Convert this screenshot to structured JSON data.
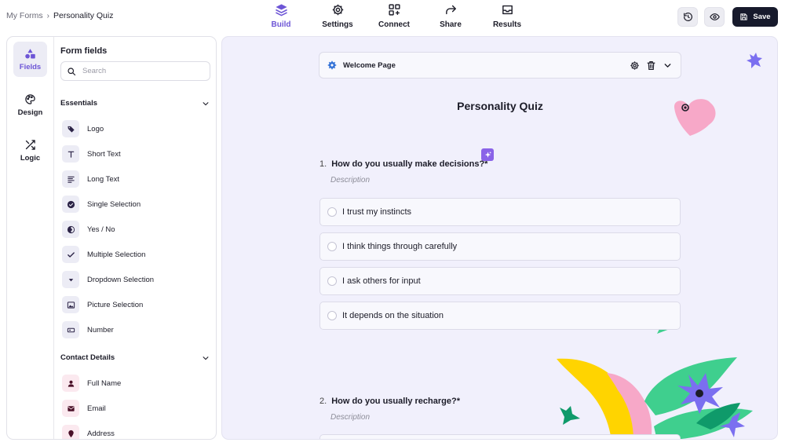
{
  "breadcrumb": {
    "parent": "My Forms",
    "separator": "›",
    "current": "Personality Quiz"
  },
  "nav_tabs": [
    {
      "label": "Build",
      "icon": "layers-icon",
      "active": true
    },
    {
      "label": "Settings",
      "icon": "gear-icon",
      "active": false
    },
    {
      "label": "Connect",
      "icon": "connect-icon",
      "active": false
    },
    {
      "label": "Share",
      "icon": "share-icon",
      "active": false
    },
    {
      "label": "Results",
      "icon": "inbox-icon",
      "active": false
    }
  ],
  "actions": {
    "save_label": "Save"
  },
  "rail": [
    {
      "label": "Fields",
      "icon": "shapes-icon",
      "active": true
    },
    {
      "label": "Design",
      "icon": "palette-icon",
      "active": false
    },
    {
      "label": "Logic",
      "icon": "shuffle-icon",
      "active": false
    }
  ],
  "fields_panel": {
    "title": "Form fields",
    "search_placeholder": "Search",
    "sections": [
      {
        "title": "Essentials",
        "items": [
          {
            "label": "Logo",
            "icon": "tag-icon"
          },
          {
            "label": "Short Text",
            "icon": "text-icon"
          },
          {
            "label": "Long Text",
            "icon": "paragraph-icon"
          },
          {
            "label": "Single Selection",
            "icon": "check-circle-icon"
          },
          {
            "label": "Yes / No",
            "icon": "half-circle-icon"
          },
          {
            "label": "Multiple Selection",
            "icon": "checkmark-icon"
          },
          {
            "label": "Dropdown Selection",
            "icon": "dropdown-icon"
          },
          {
            "label": "Picture Selection",
            "icon": "image-icon"
          },
          {
            "label": "Number",
            "icon": "number-icon"
          }
        ]
      },
      {
        "title": "Contact Details",
        "items": [
          {
            "label": "Full Name",
            "icon": "person-icon"
          },
          {
            "label": "Email",
            "icon": "mail-icon"
          },
          {
            "label": "Address",
            "icon": "location-icon"
          }
        ]
      }
    ]
  },
  "canvas": {
    "welcome_label": "Welcome Page",
    "form_title": "Personality Quiz",
    "questions": [
      {
        "number": "1.",
        "text": "How do you usually make decisions?*",
        "description": "Description",
        "options": [
          "I trust my instincts",
          "I think things through carefully",
          "I ask others for input",
          "It depends on the situation"
        ]
      },
      {
        "number": "2.",
        "text": "How do you usually recharge?*",
        "description": "Description"
      }
    ]
  },
  "colors": {
    "accent": "#6d55d6",
    "canvas_bg": "#f1f0fc",
    "save_bg": "#171a2c",
    "deco_green": "#3fcf8e",
    "deco_yellow": "#ffd400",
    "deco_pink": "#f7a8c8",
    "deco_purple": "#7b6ff0"
  }
}
